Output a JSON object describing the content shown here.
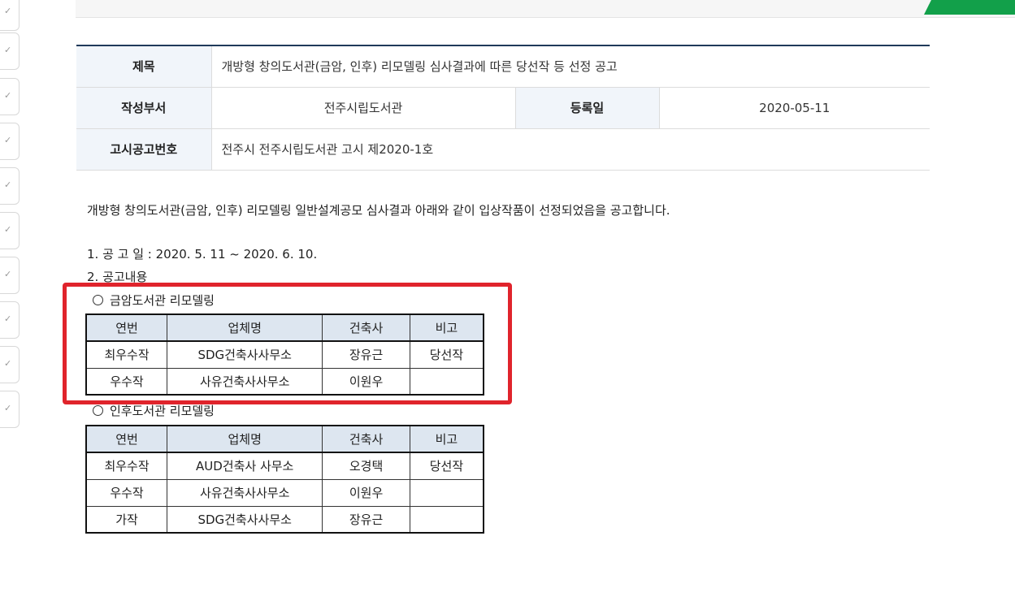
{
  "info": {
    "title_label": "제목",
    "title_value": "개방형 창의도서관(금암, 인후) 리모델링 심사결과에 따른 당선작 등 선정 공고",
    "dept_label": "작성부서",
    "dept_value": "전주시립도서관",
    "date_label": "등록일",
    "date_value": "2020-05-11",
    "notice_label": "고시공고번호",
    "notice_value": "전주시 전주시립도서관 고시 제2020-1호"
  },
  "content": {
    "intro": "개방형 창의도서관(금암, 인후) 리모델링 일반설계공모 심사결과 아래와 같이 입상작품이 선정되었음을 공고합니다.",
    "period": "1. 공 고 일 : 2020. 5. 11 ~ 2020. 6. 10.",
    "section2": "2. 공고내용"
  },
  "tables": [
    {
      "title": "금암도서관 리모델링",
      "headers": [
        "연번",
        "업체명",
        "건축사",
        "비고"
      ],
      "rows": [
        [
          "최우수작",
          "SDG건축사사무소",
          "장유근",
          "당선작"
        ],
        [
          "우수작",
          "사유건축사사무소",
          "이원우",
          ""
        ]
      ]
    },
    {
      "title": "인후도서관 리모델링",
      "headers": [
        "연번",
        "업체명",
        "건축사",
        "비고"
      ],
      "rows": [
        [
          "최우수작",
          "AUD건축사 사무소",
          "오경택",
          "당선작"
        ],
        [
          "우수작",
          "사유건축사사무소",
          "이원우",
          ""
        ],
        [
          "가작",
          "SDG건축사사무소",
          "장유근",
          ""
        ]
      ]
    }
  ],
  "colors": {
    "highlight": "#e0242c",
    "accent_green": "#12a04a",
    "header_bg": "#f1f5fa",
    "table_header_bg": "#dde6f0"
  }
}
